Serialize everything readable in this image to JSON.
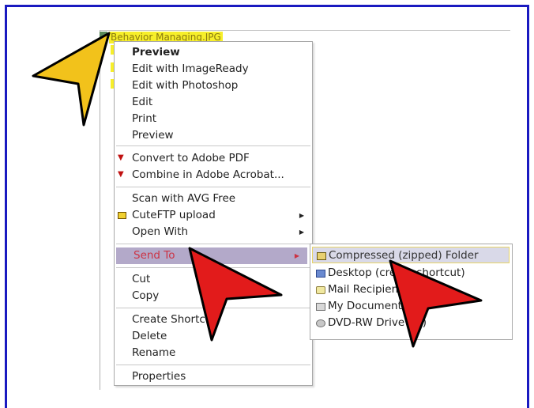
{
  "file": {
    "name": "Behavior Managing.JPG"
  },
  "context_menu": {
    "items": [
      {
        "label": "Preview",
        "bold": true
      },
      {
        "label": "Edit with ImageReady"
      },
      {
        "label": "Edit with Photoshop"
      },
      {
        "label": "Edit"
      },
      {
        "label": "Print"
      },
      {
        "label": "Preview"
      },
      {
        "label": "Convert to Adobe PDF",
        "icon": "pdf-icon"
      },
      {
        "label": "Combine in Adobe Acrobat...",
        "icon": "pdf-icon"
      },
      {
        "label": "Scan with AVG Free"
      },
      {
        "label": "CuteFTP upload",
        "icon": "ftp-icon",
        "submenu": true
      },
      {
        "label": "Open With",
        "submenu": true
      },
      {
        "label": "Send To",
        "submenu": true,
        "highlighted": true
      },
      {
        "label": "Cut"
      },
      {
        "label": "Copy"
      },
      {
        "label": "Create Shortcut"
      },
      {
        "label": "Delete"
      },
      {
        "label": "Rename"
      },
      {
        "label": "Properties"
      }
    ]
  },
  "send_to_submenu": {
    "items": [
      {
        "label": "Compressed (zipped) Folder",
        "icon": "zip-folder-icon",
        "highlighted": true
      },
      {
        "label": "Desktop (create shortcut)",
        "icon": "desktop-icon"
      },
      {
        "label": "Mail Recipient",
        "icon": "mail-icon"
      },
      {
        "label": "My Documents",
        "icon": "documents-icon"
      },
      {
        "label": "DVD-RW Drive (E:)",
        "icon": "dvd-drive-icon"
      }
    ]
  },
  "colors": {
    "frame_border": "#1a1ac0",
    "file_highlight": "#f7ef2a",
    "menu_highlight": "#b3a9c9",
    "highlight_text": "#cc3344",
    "yellow_pointer": "#f2c21b",
    "red_pointer": "#e21b1b"
  }
}
